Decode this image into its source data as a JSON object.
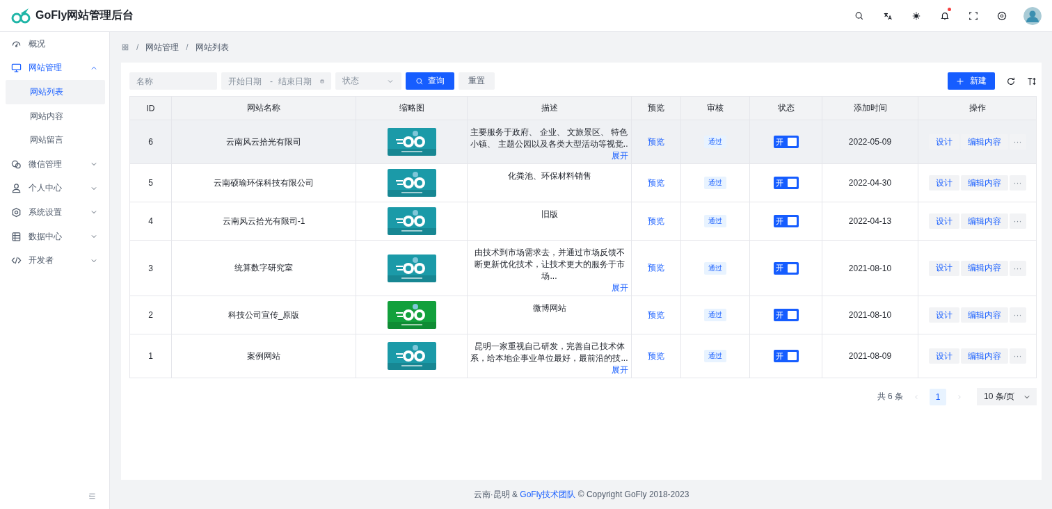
{
  "header": {
    "title": "GoFly网站管理后台",
    "notifications_unread": true
  },
  "sidebar": {
    "items": [
      {
        "label": "概况",
        "selected": false
      },
      {
        "label": "网站管理",
        "selected": false,
        "expanded": true,
        "children": [
          {
            "label": "网站列表",
            "selected": true
          },
          {
            "label": "网站内容",
            "selected": false
          },
          {
            "label": "网站留言",
            "selected": false
          }
        ]
      },
      {
        "label": "微信管理",
        "selected": false,
        "expanded": false
      },
      {
        "label": "个人中心",
        "selected": false,
        "expanded": false
      },
      {
        "label": "系统设置",
        "selected": false,
        "expanded": false
      },
      {
        "label": "数据中心",
        "selected": false,
        "expanded": false
      },
      {
        "label": "开发者",
        "selected": false,
        "expanded": false
      }
    ]
  },
  "breadcrumb": {
    "separator": "/",
    "items": [
      "网站管理",
      "网站列表"
    ]
  },
  "filters": {
    "name_placeholder": "名称",
    "start_placeholder": "开始日期",
    "range_separator": "-",
    "end_placeholder": "结束日期",
    "status_placeholder": "状态",
    "search_button": "查询",
    "reset_button": "重置",
    "new_button": "新建"
  },
  "table": {
    "columns": [
      "ID",
      "网站名称",
      "缩略图",
      "描述",
      "预览",
      "审核",
      "状态",
      "添加时间",
      "操作"
    ],
    "rows": [
      {
        "id": "6",
        "name": "云南风云拾光有限司",
        "description": "主要服务于政府、 企业、 文旅景区、 特色小镇、 主题公园以及各类大型活动等视觉..",
        "expand": "展开",
        "preview": "预览",
        "audit": "通过",
        "status_label": "开",
        "status_on": true,
        "added": "2022-05-09",
        "actions": [
          "设计",
          "编辑内容",
          "···"
        ],
        "hovered": true
      },
      {
        "id": "5",
        "name": "云南硕瑜环保科技有限公司",
        "description": "化粪池、环保材料销售",
        "preview": "预览",
        "audit": "通过",
        "status_label": "开",
        "status_on": true,
        "added": "2022-04-30",
        "actions": [
          "设计",
          "编辑内容",
          "···"
        ],
        "hovered": false
      },
      {
        "id": "4",
        "name": "云南风云拾光有限司-1",
        "description": "旧版",
        "preview": "预览",
        "audit": "通过",
        "status_label": "开",
        "status_on": true,
        "added": "2022-04-13",
        "actions": [
          "设计",
          "编辑内容",
          "···"
        ],
        "hovered": false
      },
      {
        "id": "3",
        "name": "统算数字研究室",
        "description": "由技术到市场需求去，并通过市场反馈不断更新优化技术，让技术更大的服务于市场...",
        "expand": "展开",
        "preview": "预览",
        "audit": "通过",
        "status_label": "开",
        "status_on": true,
        "added": "2021-08-10",
        "actions": [
          "设计",
          "编辑内容",
          "···"
        ],
        "hovered": false
      },
      {
        "id": "2",
        "name": "科技公司宣传_原版",
        "description": "微博网站",
        "preview": "预览",
        "audit": "通过",
        "status_label": "开",
        "status_on": true,
        "added": "2021-08-10",
        "actions": [
          "设计",
          "编辑内容",
          "···"
        ],
        "hovered": false
      },
      {
        "id": "1",
        "name": "案例网站",
        "description": "昆明一家重视自己研发，完善自己技术体系，给本地企事业单位最好，最前沿的技...",
        "expand": "展开",
        "preview": "预览",
        "audit": "通过",
        "status_label": "开",
        "status_on": true,
        "added": "2021-08-09",
        "actions": [
          "设计",
          "编辑内容",
          "···"
        ],
        "hovered": false
      }
    ]
  },
  "pagination": {
    "total": "共 6 条",
    "pages": [
      {
        "label": "1",
        "selected": true
      }
    ],
    "page_size": "10 条/页"
  },
  "footer": {
    "prefix": "云南·昆明 &",
    "link": "GoFly技术团队",
    "suffix": "© Copyright GoFly 2018-2023"
  }
}
